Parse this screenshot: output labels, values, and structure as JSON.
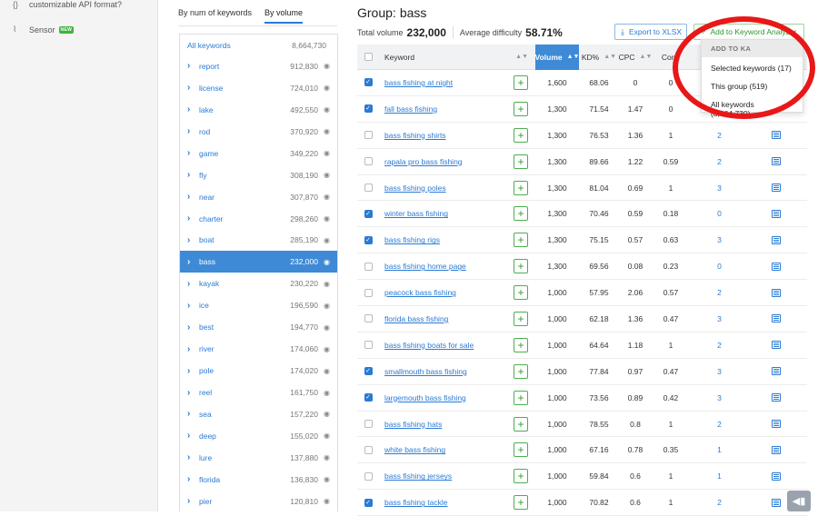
{
  "sidebar": {
    "items": [
      {
        "icon": "api-icon",
        "glyph": "{}",
        "label": "customizable API format?"
      },
      {
        "icon": "sensor-icon",
        "glyph": "⌇",
        "label": "Sensor",
        "badge": "NEW"
      }
    ]
  },
  "tabs": [
    {
      "label": "By num of keywords",
      "active": false
    },
    {
      "label": "By volume",
      "active": true
    }
  ],
  "groups": [
    {
      "name": "All keywords",
      "count": "8,664,730",
      "all": true
    },
    {
      "name": "report",
      "count": "912,830"
    },
    {
      "name": "license",
      "count": "724,010"
    },
    {
      "name": "lake",
      "count": "492,550"
    },
    {
      "name": "rod",
      "count": "370,920"
    },
    {
      "name": "game",
      "count": "349,220"
    },
    {
      "name": "fly",
      "count": "308,190"
    },
    {
      "name": "near",
      "count": "307,870"
    },
    {
      "name": "charter",
      "count": "298,260"
    },
    {
      "name": "boat",
      "count": "285,190"
    },
    {
      "name": "bass",
      "count": "232,000",
      "active": true
    },
    {
      "name": "kayak",
      "count": "230,220"
    },
    {
      "name": "ice",
      "count": "196,590"
    },
    {
      "name": "best",
      "count": "194,770"
    },
    {
      "name": "river",
      "count": "174,060"
    },
    {
      "name": "pole",
      "count": "174,020"
    },
    {
      "name": "reel",
      "count": "161,750"
    },
    {
      "name": "sea",
      "count": "157,220"
    },
    {
      "name": "deep",
      "count": "155,020"
    },
    {
      "name": "lure",
      "count": "137,880"
    },
    {
      "name": "florida",
      "count": "136,830"
    },
    {
      "name": "pier",
      "count": "120,810"
    }
  ],
  "header": {
    "group_label": "Group:",
    "group_value": "bass",
    "total_volume_label": "Total volume",
    "total_volume": "232,000",
    "avg_difficulty_label": "Average difficulty",
    "avg_difficulty": "58.71%",
    "export_label": "Export to XLSX",
    "add_ka_label": "Add to Keyword Analyzer"
  },
  "dropdown": {
    "heading": "ADD TO KA",
    "options": [
      "Selected keywords (17)",
      "This group (519)",
      "All keywords (8,664,730)"
    ]
  },
  "table": {
    "columns": {
      "keyword": "Keyword",
      "volume": "Volume",
      "kd": "KD%",
      "cpc": "CPC",
      "com": "Com."
    },
    "rows": [
      {
        "checked": true,
        "keyword": "bass fishing at night",
        "volume": "1,600",
        "kd": "68.06",
        "cpc": "0",
        "com": "0",
        "results": "",
        "serp": false
      },
      {
        "checked": true,
        "keyword": "fall bass fishing",
        "volume": "1,300",
        "kd": "71.54",
        "cpc": "1.47",
        "com": "0",
        "results": "",
        "serp": false
      },
      {
        "checked": false,
        "keyword": "bass fishing shirts",
        "volume": "1,300",
        "kd": "76.53",
        "cpc": "1.36",
        "com": "1",
        "results": "2",
        "serp": true
      },
      {
        "checked": false,
        "keyword": "rapala pro bass fishing",
        "volume": "1,300",
        "kd": "89.66",
        "cpc": "1.22",
        "com": "0.59",
        "results": "2",
        "serp": true
      },
      {
        "checked": false,
        "keyword": "bass fishing poles",
        "volume": "1,300",
        "kd": "81.04",
        "cpc": "0.69",
        "com": "1",
        "results": "3",
        "serp": true
      },
      {
        "checked": true,
        "keyword": "winter bass fishing",
        "volume": "1,300",
        "kd": "70.46",
        "cpc": "0.59",
        "com": "0.18",
        "results": "0",
        "serp": true
      },
      {
        "checked": true,
        "keyword": "bass fishing rigs",
        "volume": "1,300",
        "kd": "75.15",
        "cpc": "0.57",
        "com": "0.63",
        "results": "3",
        "serp": true
      },
      {
        "checked": false,
        "keyword": "bass fishing home page",
        "volume": "1,300",
        "kd": "69.56",
        "cpc": "0.08",
        "com": "0.23",
        "results": "0",
        "serp": true
      },
      {
        "checked": false,
        "keyword": "peacock bass fishing",
        "volume": "1,000",
        "kd": "57.95",
        "cpc": "2.06",
        "com": "0.57",
        "results": "2",
        "serp": true
      },
      {
        "checked": false,
        "keyword": "florida bass fishing",
        "volume": "1,000",
        "kd": "62.18",
        "cpc": "1.36",
        "com": "0.47",
        "results": "3",
        "serp": true
      },
      {
        "checked": false,
        "keyword": "bass fishing boats for sale",
        "volume": "1,000",
        "kd": "64.64",
        "cpc": "1.18",
        "com": "1",
        "results": "2",
        "serp": true
      },
      {
        "checked": true,
        "keyword": "smallmouth bass fishing",
        "volume": "1,000",
        "kd": "77.84",
        "cpc": "0.97",
        "com": "0.47",
        "results": "3",
        "serp": true
      },
      {
        "checked": true,
        "keyword": "largemouth bass fishing",
        "volume": "1,000",
        "kd": "73.56",
        "cpc": "0.89",
        "com": "0.42",
        "results": "3",
        "serp": true
      },
      {
        "checked": false,
        "keyword": "bass fishing hats",
        "volume": "1,000",
        "kd": "78.55",
        "cpc": "0.8",
        "com": "1",
        "results": "2",
        "serp": true
      },
      {
        "checked": false,
        "keyword": "white bass fishing",
        "volume": "1,000",
        "kd": "67.16",
        "cpc": "0.78",
        "com": "0.35",
        "results": "1",
        "serp": true
      },
      {
        "checked": false,
        "keyword": "bass fishing jerseys",
        "volume": "1,000",
        "kd": "59.84",
        "cpc": "0.6",
        "com": "1",
        "results": "1",
        "serp": true
      },
      {
        "checked": true,
        "keyword": "bass fishing tackle",
        "volume": "1,000",
        "kd": "70.82",
        "cpc": "0.6",
        "com": "1",
        "results": "2",
        "serp": true
      }
    ]
  },
  "colors": {
    "accent": "#2a7ad4",
    "active_bg": "#3e8ad6",
    "green": "#2e9b2e",
    "highlight_ring": "#e81818"
  }
}
